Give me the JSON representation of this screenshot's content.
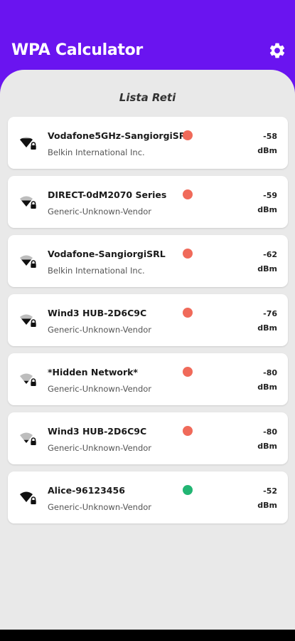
{
  "app": {
    "title": "WPA Calculator",
    "settings_icon": "gear-icon",
    "accent_color": "#6a14f0"
  },
  "list": {
    "title": "Lista Reti",
    "networks": [
      {
        "name": "Vodafone5GHz-SangiorgiSRL",
        "vendor": "Belkin International Inc.",
        "signal": "-58",
        "unit": "dBm",
        "status_color": "#f06a5a",
        "icon": "wifi-locked-icon",
        "signal_level": 0.75
      },
      {
        "name": "DIRECT-0dM2070 Series",
        "vendor": "Generic-Unknown-Vendor",
        "signal": "-59",
        "unit": "dBm",
        "status_color": "#f06a5a",
        "icon": "wifi-locked-icon",
        "signal_level": 0.5
      },
      {
        "name": "Vodafone-SangiorgiSRL",
        "vendor": "Belkin International Inc.",
        "signal": "-62",
        "unit": "dBm",
        "status_color": "#f06a5a",
        "icon": "wifi-locked-icon",
        "signal_level": 0.5
      },
      {
        "name": "Wind3 HUB-2D6C9C",
        "vendor": "Generic-Unknown-Vendor",
        "signal": "-76",
        "unit": "dBm",
        "status_color": "#f06a5a",
        "icon": "wifi-locked-icon",
        "signal_level": 0.5
      },
      {
        "name": "*Hidden Network*",
        "vendor": "Generic-Unknown-Vendor",
        "signal": "-80",
        "unit": "dBm",
        "status_color": "#f06a5a",
        "icon": "wifi-locked-icon",
        "signal_level": 0.25
      },
      {
        "name": "Wind3 HUB-2D6C9C",
        "vendor": "Generic-Unknown-Vendor",
        "signal": "-80",
        "unit": "dBm",
        "status_color": "#f06a5a",
        "icon": "wifi-locked-icon",
        "signal_level": 0.25
      },
      {
        "name": "Alice-96123456",
        "vendor": "Generic-Unknown-Vendor",
        "signal": "-52",
        "unit": "dBm",
        "status_color": "#22b573",
        "icon": "wifi-locked-icon",
        "signal_level": 1.0
      }
    ]
  }
}
